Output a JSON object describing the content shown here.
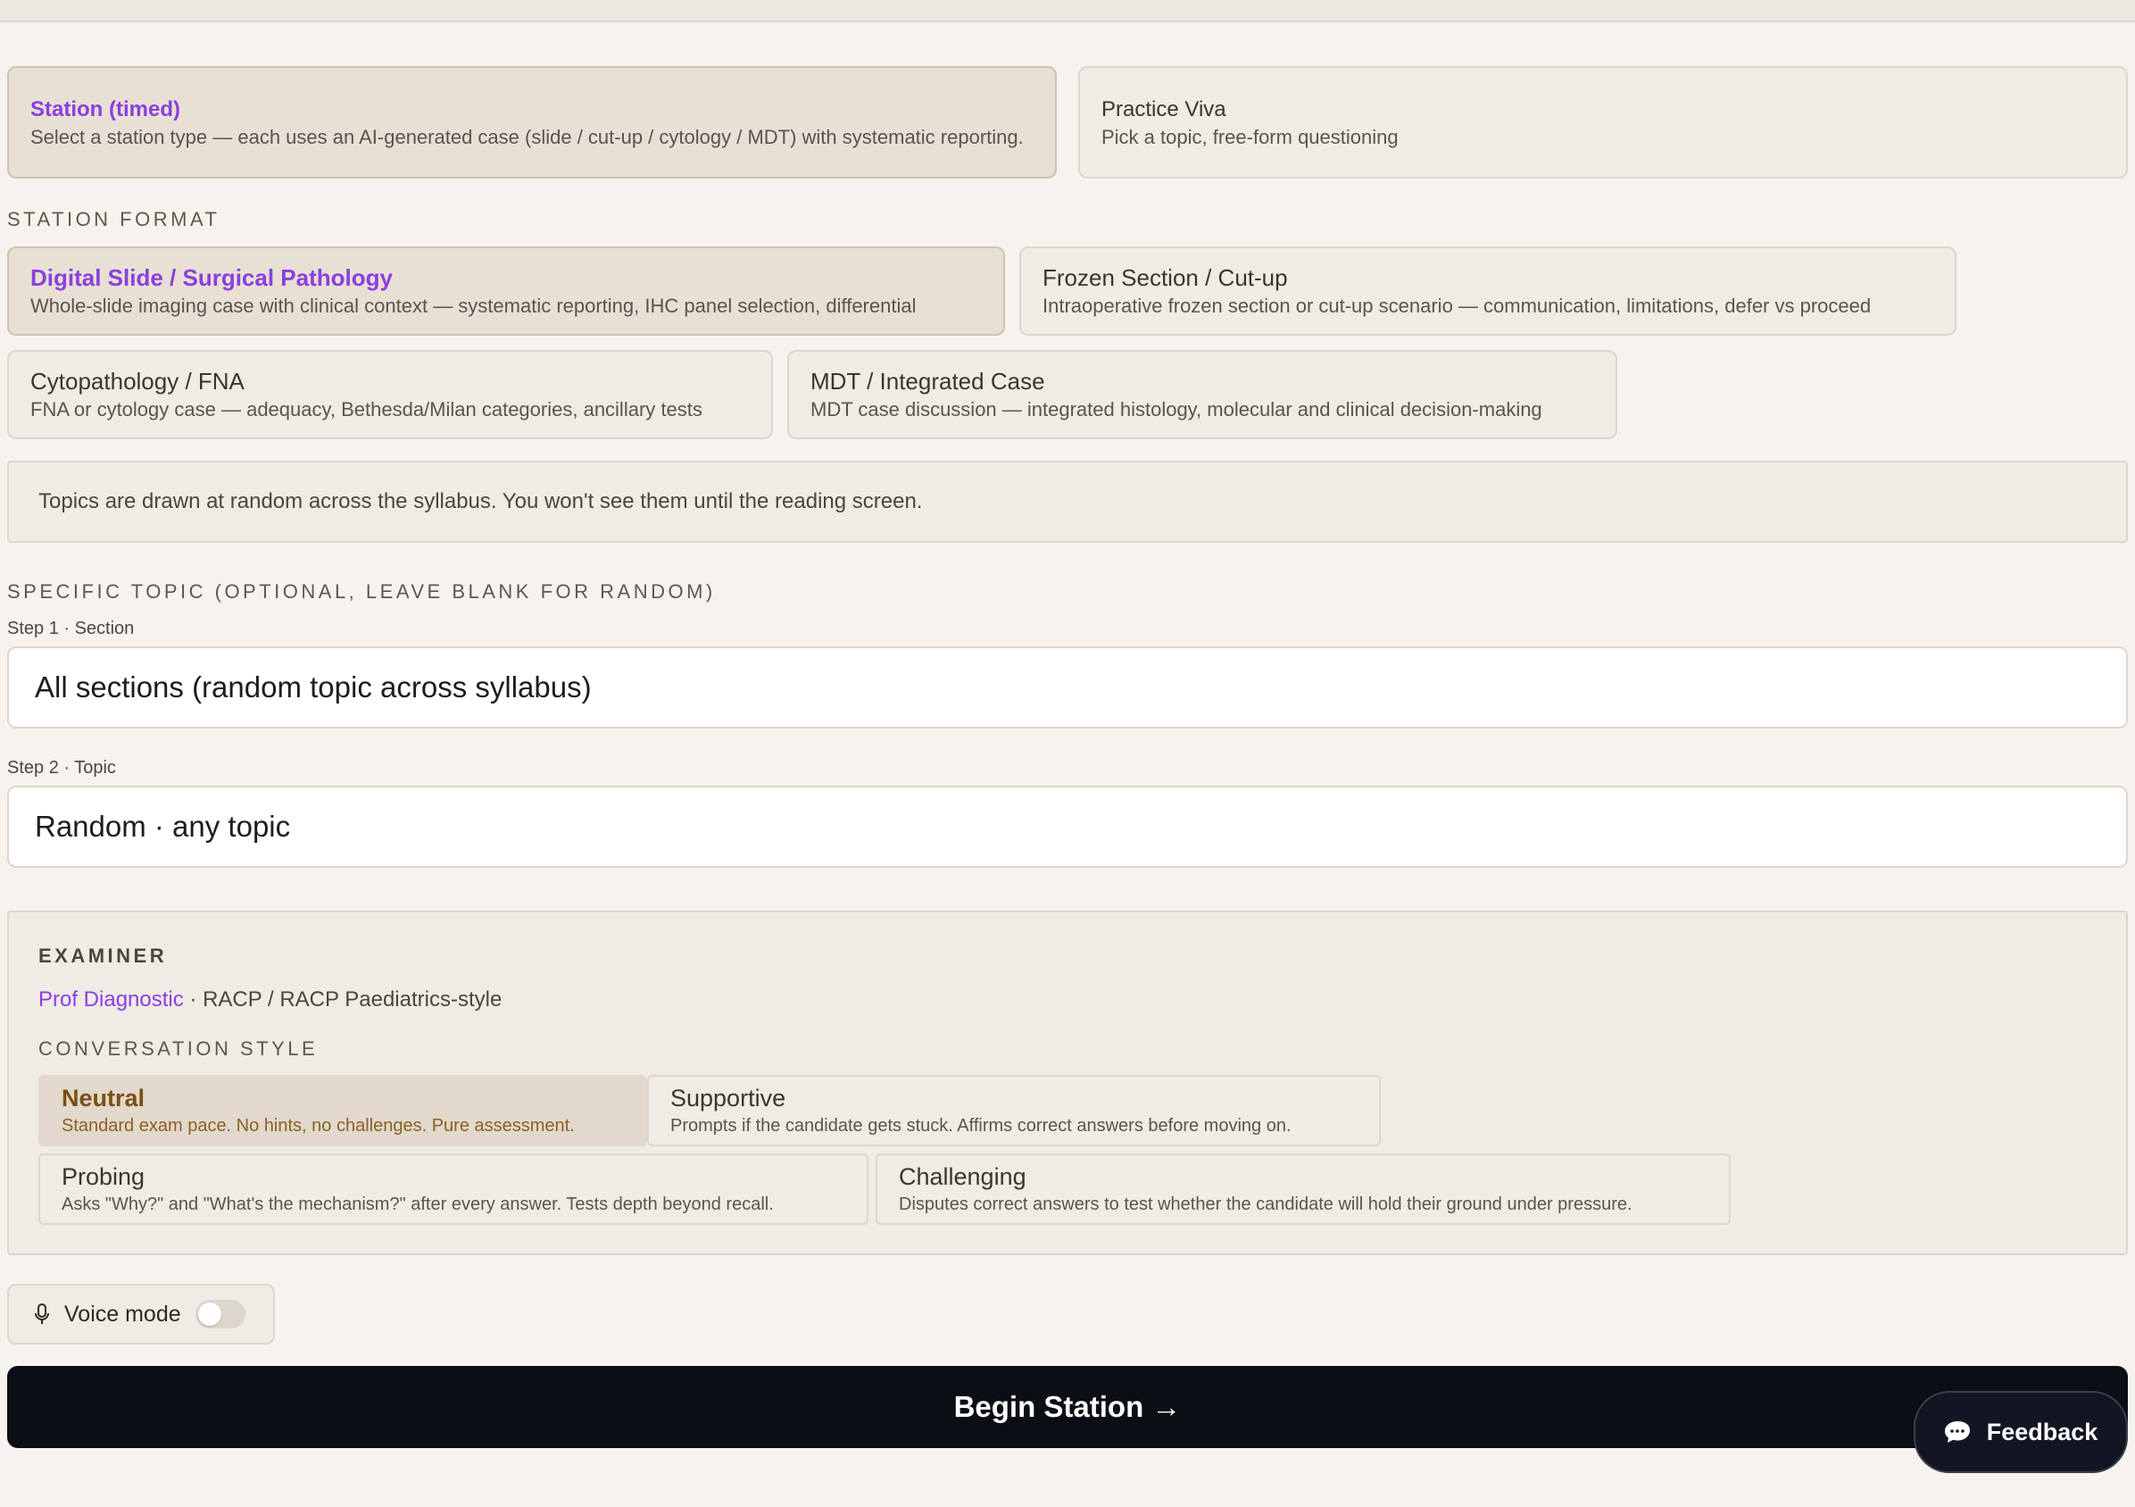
{
  "modes": [
    {
      "title": "Station (timed)",
      "desc": "Select a station type — each uses an AI-generated case (slide / cut-up / cytology / MDT) with systematic reporting."
    },
    {
      "title": "Practice Viva",
      "desc": "Pick a topic, free-form questioning"
    }
  ],
  "station_format": {
    "label": "STATION FORMAT",
    "options": [
      {
        "title": "Digital Slide / Surgical Pathology",
        "desc": "Whole-slide imaging case with clinical context — systematic reporting, IHC panel selection, differential"
      },
      {
        "title": "Frozen Section / Cut-up",
        "desc": "Intraoperative frozen section or cut-up scenario — communication, limitations, defer vs proceed"
      },
      {
        "title": "Cytopathology / FNA",
        "desc": "FNA or cytology case — adequacy, Bethesda/Milan categories, ancillary tests"
      },
      {
        "title": "MDT / Integrated Case",
        "desc": "MDT case discussion — integrated histology, molecular and clinical decision-making"
      }
    ]
  },
  "info_text": "Topics are drawn at random across the syllabus. You won't see them until the reading screen.",
  "specific_topic": {
    "label": "SPECIFIC TOPIC (OPTIONAL, LEAVE BLANK FOR RANDOM)",
    "step1_label": "Step 1 · Section",
    "step1_value": "All sections (random topic across syllabus)",
    "step2_label": "Step 2 · Topic",
    "step2_value": "Random · any topic"
  },
  "examiner": {
    "heading": "EXAMINER",
    "name": "Prof Diagnostic",
    "style": "· RACP / RACP Paediatrics-style",
    "conversation_label": "CONVERSATION STYLE",
    "styles": [
      {
        "title": "Neutral",
        "desc": "Standard exam pace. No hints, no challenges. Pure assessment."
      },
      {
        "title": "Supportive",
        "desc": "Prompts if the candidate gets stuck. Affirms correct answers before moving on."
      },
      {
        "title": "Probing",
        "desc": "Asks \"Why?\" and \"What's the mechanism?\" after every answer. Tests depth beyond recall."
      },
      {
        "title": "Challenging",
        "desc": "Disputes correct answers to test whether the candidate will hold their ground under pressure."
      }
    ]
  },
  "voice_mode": {
    "label": "Voice mode",
    "enabled": false,
    "icon": "microphone-icon"
  },
  "begin_label": "Begin Station →",
  "feedback_label": "Feedback",
  "feedback_icon": "chat-bubble-icon",
  "colors": {
    "accent": "#8b3fe0",
    "selected_style": "#7a4f12",
    "button_bg": "#0c0e15",
    "page_bg": "#f6f3ee"
  }
}
